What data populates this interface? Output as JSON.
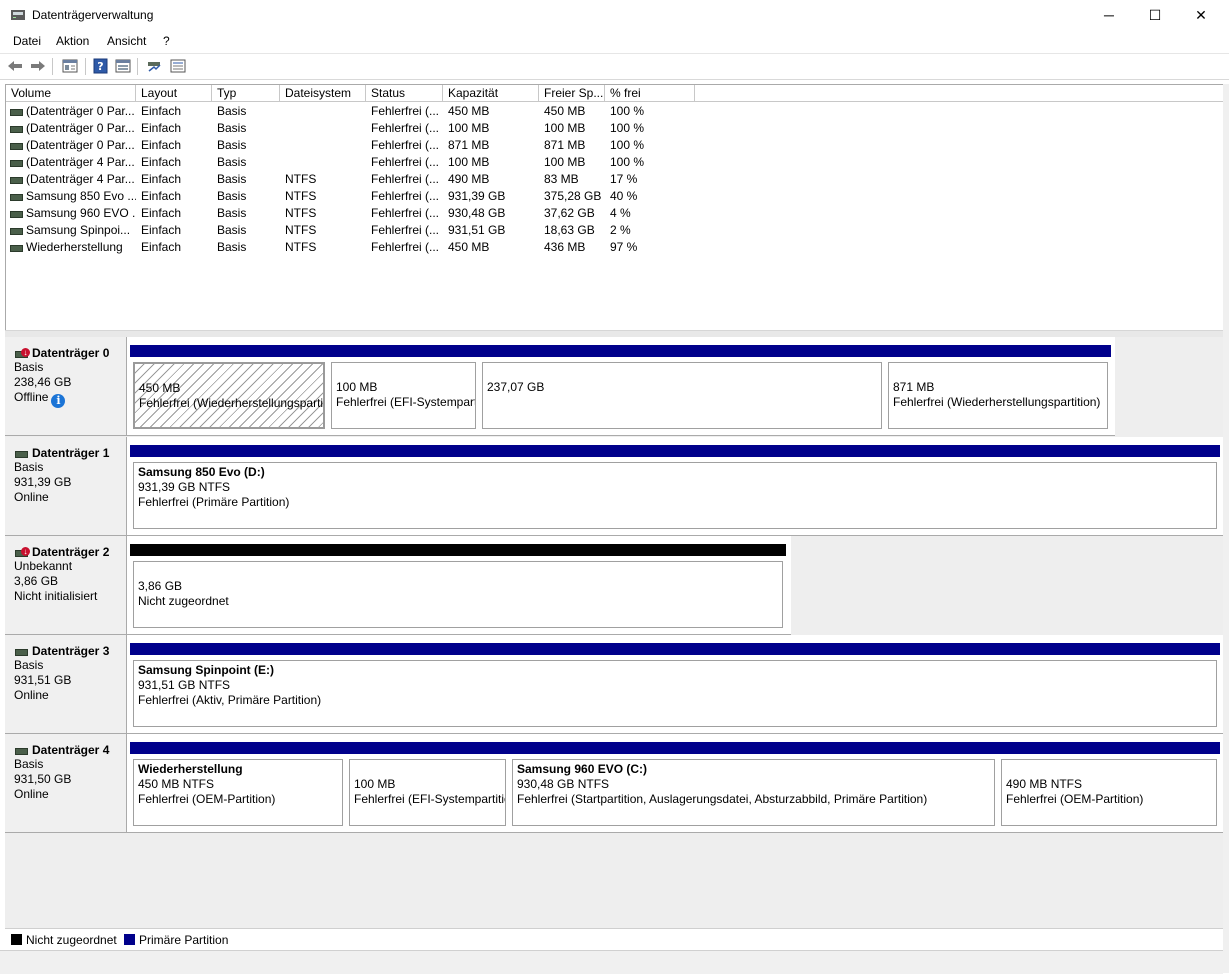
{
  "window": {
    "title": "Datenträgerverwaltung",
    "minimize": "─",
    "maximize": "☐",
    "close": "✕"
  },
  "menu": [
    "Datei",
    "Aktion",
    "Ansicht",
    "?"
  ],
  "toolbar": [
    "back-icon",
    "forward-icon",
    "properties-icon",
    "help-icon",
    "console-icon",
    "connect-icon",
    "details-icon"
  ],
  "columns": [
    "Volume",
    "Layout",
    "Typ",
    "Dateisystem",
    "Status",
    "Kapazität",
    "Freier Sp...",
    "% frei"
  ],
  "volumes": [
    {
      "name": "(Datenträger 0 Par...",
      "layout": "Einfach",
      "type": "Basis",
      "fs": "",
      "status": "Fehlerfrei (...",
      "capacity": "450 MB",
      "free": "450 MB",
      "pct": "100 %"
    },
    {
      "name": "(Datenträger 0 Par...",
      "layout": "Einfach",
      "type": "Basis",
      "fs": "",
      "status": "Fehlerfrei (...",
      "capacity": "100 MB",
      "free": "100 MB",
      "pct": "100 %"
    },
    {
      "name": "(Datenträger 0 Par...",
      "layout": "Einfach",
      "type": "Basis",
      "fs": "",
      "status": "Fehlerfrei (...",
      "capacity": "871 MB",
      "free": "871 MB",
      "pct": "100 %"
    },
    {
      "name": "(Datenträger 4 Par...",
      "layout": "Einfach",
      "type": "Basis",
      "fs": "",
      "status": "Fehlerfrei (...",
      "capacity": "100 MB",
      "free": "100 MB",
      "pct": "100 %"
    },
    {
      "name": "(Datenträger 4 Par...",
      "layout": "Einfach",
      "type": "Basis",
      "fs": "NTFS",
      "status": "Fehlerfrei (...",
      "capacity": "490 MB",
      "free": "83 MB",
      "pct": "17 %"
    },
    {
      "name": "Samsung 850 Evo ...",
      "layout": "Einfach",
      "type": "Basis",
      "fs": "NTFS",
      "status": "Fehlerfrei (...",
      "capacity": "931,39 GB",
      "free": "375,28 GB",
      "pct": "40 %"
    },
    {
      "name": "Samsung 960 EVO ...",
      "layout": "Einfach",
      "type": "Basis",
      "fs": "NTFS",
      "status": "Fehlerfrei (...",
      "capacity": "930,48 GB",
      "free": "37,62 GB",
      "pct": "4 %"
    },
    {
      "name": "Samsung Spinpoi...",
      "layout": "Einfach",
      "type": "Basis",
      "fs": "NTFS",
      "status": "Fehlerfrei (...",
      "capacity": "931,51 GB",
      "free": "18,63 GB",
      "pct": "2 %"
    },
    {
      "name": "Wiederherstellung",
      "layout": "Einfach",
      "type": "Basis",
      "fs": "NTFS",
      "status": "Fehlerfrei (...",
      "capacity": "450 MB",
      "free": "436 MB",
      "pct": "97 %"
    }
  ],
  "disks": [
    {
      "name": "Datenträger 0",
      "type": "Basis",
      "size": "238,46 GB",
      "state": "Offline",
      "error": true,
      "info": true,
      "partitions": [
        {
          "title": "",
          "l1": "450 MB",
          "l2": "Fehlerfrei (Wiederherstellungspartit",
          "hatch": true
        },
        {
          "title": "",
          "l1": "100 MB",
          "l2": "Fehlerfrei (EFI-Systempart"
        },
        {
          "title": "",
          "l1": "237,07 GB",
          "l2": ""
        },
        {
          "title": "",
          "l1": "871 MB",
          "l2": "Fehlerfrei (Wiederherstellungspartition)"
        }
      ]
    },
    {
      "name": "Datenträger 1",
      "type": "Basis",
      "size": "931,39 GB",
      "state": "Online",
      "partitions": [
        {
          "title": "Samsung 850 Evo  (D:)",
          "l1": "931,39 GB NTFS",
          "l2": "Fehlerfrei (Primäre Partition)"
        }
      ]
    },
    {
      "name": "Datenträger 2",
      "type": "Unbekannt",
      "size": "3,86 GB",
      "state": "Nicht initialisiert",
      "error": true,
      "partitions": [
        {
          "title": "",
          "l1": "3,86 GB",
          "l2": "Nicht zugeordnet",
          "unalloc": true
        }
      ]
    },
    {
      "name": "Datenträger 3",
      "type": "Basis",
      "size": "931,51 GB",
      "state": "Online",
      "partitions": [
        {
          "title": "Samsung Spinpoint  (E:)",
          "l1": "931,51 GB NTFS",
          "l2": "Fehlerfrei (Aktiv, Primäre Partition)"
        }
      ]
    },
    {
      "name": "Datenträger 4",
      "type": "Basis",
      "size": "931,50 GB",
      "state": "Online",
      "partitions": [
        {
          "title": "Wiederherstellung",
          "l1": "450 MB NTFS",
          "l2": "Fehlerfrei (OEM-Partition)"
        },
        {
          "title": "",
          "l1": "100 MB",
          "l2": "Fehlerfrei (EFI-Systempartitio"
        },
        {
          "title": "Samsung 960 EVO  (C:)",
          "l1": "930,48 GB NTFS",
          "l2": "Fehlerfrei (Startpartition, Auslagerungsdatei, Absturzabbild, Primäre Partition)"
        },
        {
          "title": "",
          "l1": "490 MB NTFS",
          "l2": "Fehlerfrei (OEM-Partition)"
        }
      ]
    }
  ],
  "legend": [
    {
      "label": "Nicht zugeordnet",
      "color": "#000000"
    },
    {
      "label": "Primäre Partition",
      "color": "#00008b"
    }
  ]
}
